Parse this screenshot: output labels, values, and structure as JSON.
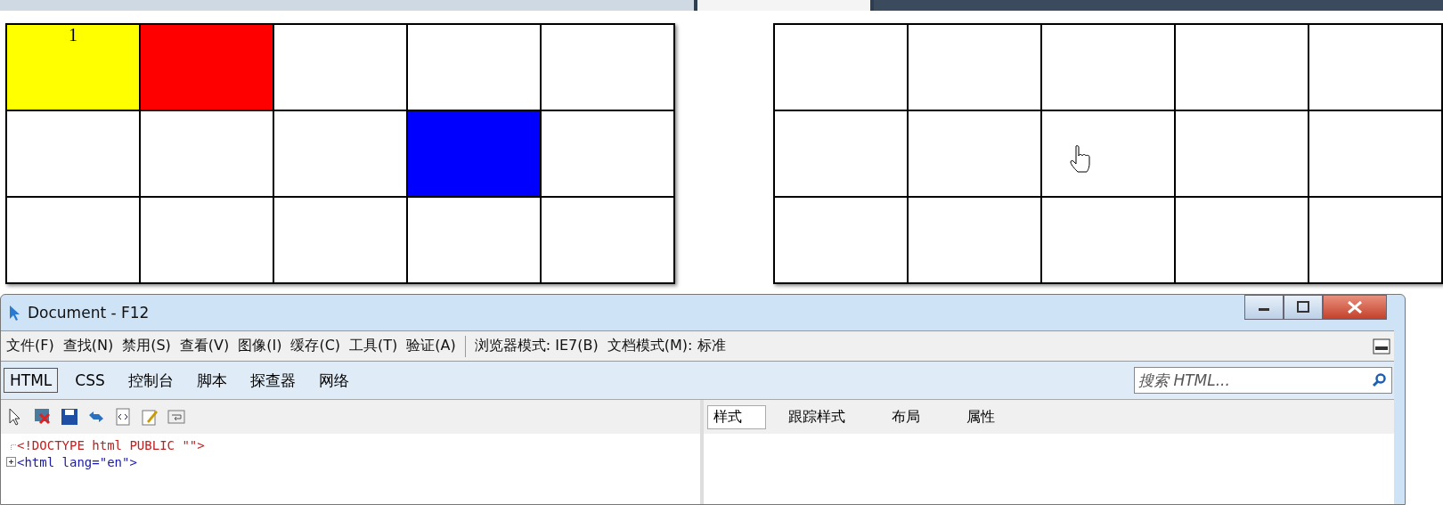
{
  "grids": [
    {
      "rows": [
        [
          {
            "color": "#ffff00",
            "text": "1"
          },
          {
            "color": "#ff0000"
          },
          {
            "color": "#ffffff"
          },
          {
            "color": "#ffffff"
          },
          {
            "color": "#ffffff"
          }
        ],
        [
          {
            "color": "#ffffff"
          },
          {
            "color": "#ffffff"
          },
          {
            "color": "#ffffff"
          },
          {
            "color": "#0000ff"
          },
          {
            "color": "#ffffff"
          }
        ],
        [
          {
            "color": "#ffffff"
          },
          {
            "color": "#ffffff"
          },
          {
            "color": "#ffffff"
          },
          {
            "color": "#ffffff"
          },
          {
            "color": "#ffffff"
          }
        ]
      ]
    },
    {
      "rows": [
        [
          {
            "color": "#ffffff"
          },
          {
            "color": "#ffffff"
          },
          {
            "color": "#ffffff"
          },
          {
            "color": "#ffffff"
          },
          {
            "color": "#ffffff"
          }
        ],
        [
          {
            "color": "#ffffff"
          },
          {
            "color": "#ffffff"
          },
          {
            "color": "#ffffff"
          },
          {
            "color": "#ffffff"
          },
          {
            "color": "#ffffff"
          }
        ],
        [
          {
            "color": "#ffffff"
          },
          {
            "color": "#ffffff"
          },
          {
            "color": "#ffffff"
          },
          {
            "color": "#ffffff"
          },
          {
            "color": "#ffffff"
          }
        ]
      ]
    }
  ],
  "devtools": {
    "title": "Document - F12",
    "menu": [
      "文件(F)",
      "查找(N)",
      "禁用(S)",
      "查看(V)",
      "图像(I)",
      "缓存(C)",
      "工具(T)",
      "验证(A)"
    ],
    "modes": [
      "浏览器模式: IE7(B)",
      "文档模式(M): 标准"
    ],
    "tabs": [
      {
        "label": "HTML",
        "selected": true
      },
      {
        "label": "CSS",
        "selected": false
      },
      {
        "label": "控制台",
        "selected": false
      },
      {
        "label": "脚本",
        "selected": false
      },
      {
        "label": "探查器",
        "selected": false
      },
      {
        "label": "网络",
        "selected": false
      }
    ],
    "search": {
      "placeholder": "搜索 HTML..."
    },
    "side_tabs": [
      {
        "label": "样式",
        "selected": true
      },
      {
        "label": "跟踪样式",
        "selected": false
      },
      {
        "label": "布局",
        "selected": false
      },
      {
        "label": "属性",
        "selected": false
      }
    ],
    "tree": [
      {
        "kind": "doctype",
        "text": "<!DOCTYPE html PUBLIC \"\">"
      },
      {
        "kind": "element",
        "text": "<html lang=\"en\">"
      }
    ]
  }
}
